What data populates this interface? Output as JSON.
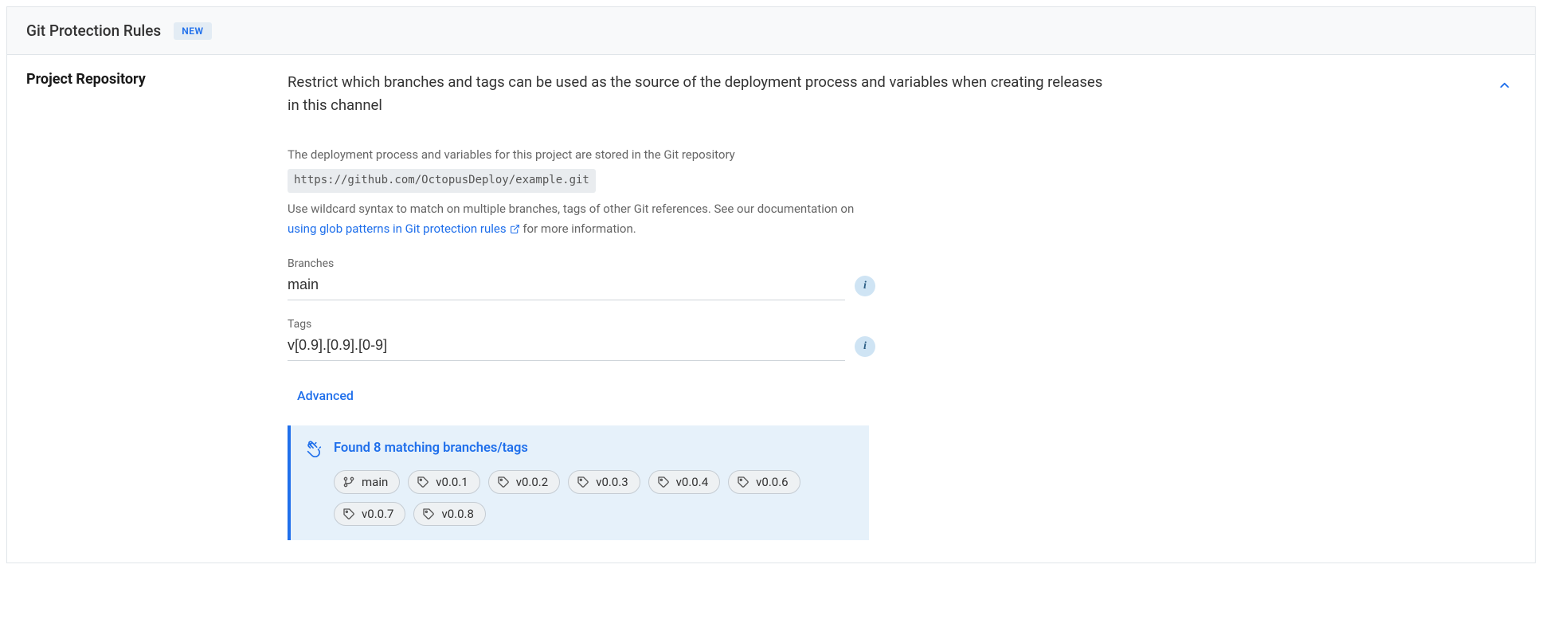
{
  "header": {
    "title": "Git Protection Rules",
    "badge": "NEW"
  },
  "section": {
    "label": "Project Repository",
    "description": "Restrict which branches and tags can be used as the source of the deployment process and variables when creating releases in this channel"
  },
  "help": {
    "line1": "The deployment process and variables for this project are stored in the Git repository",
    "repoUrl": "https://github.com/OctopusDeploy/example.git",
    "line2pre": "Use wildcard syntax to match on multiple branches, tags of other Git references. See our documentation on ",
    "docLink": "using glob patterns in Git protection rules",
    "line2post": " for more information."
  },
  "fields": {
    "branchesLabel": "Branches",
    "branchesValue": "main",
    "tagsLabel": "Tags",
    "tagsValue": "v[0.9].[0.9].[0-9]"
  },
  "advanced": "Advanced",
  "matches": {
    "title": "Found 8 matching branches/tags",
    "items": [
      {
        "type": "branch",
        "label": "main"
      },
      {
        "type": "tag",
        "label": "v0.0.1"
      },
      {
        "type": "tag",
        "label": "v0.0.2"
      },
      {
        "type": "tag",
        "label": "v0.0.3"
      },
      {
        "type": "tag",
        "label": "v0.0.4"
      },
      {
        "type": "tag",
        "label": "v0.0.6"
      },
      {
        "type": "tag",
        "label": "v0.0.7"
      },
      {
        "type": "tag",
        "label": "v0.0.8"
      }
    ]
  }
}
